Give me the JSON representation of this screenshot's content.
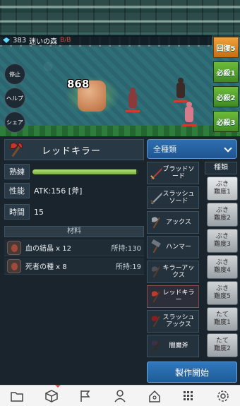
{
  "status": {
    "gems": "383",
    "area": "迷いの森",
    "area_sub": "B/B"
  },
  "side_buttons": [
    "停止",
    "ヘルプ",
    "シェア"
  ],
  "skills": [
    "回復5",
    "必殺1",
    "必殺2",
    "必殺3"
  ],
  "battle": {
    "damage": "868"
  },
  "recipe": {
    "name": "レッドキラー",
    "proficiency_label": "熟練",
    "proficiency_level": 0.98,
    "stat_label": "性能",
    "stat_value": "ATK:156 [斧]",
    "time_label": "時間",
    "time_value": "15"
  },
  "materials": {
    "title": "材料",
    "items": [
      {
        "name": "血の結晶 x 12",
        "owned": "所持:130"
      },
      {
        "name": "死者の種 x 8",
        "owned": "所持:19"
      }
    ]
  },
  "filter": {
    "selected": "全種類"
  },
  "weapons": [
    {
      "label": "ブラッドソード"
    },
    {
      "label": "スラッシュソード"
    },
    {
      "label": "アックス"
    },
    {
      "label": "ハンマー"
    },
    {
      "label": "キラーアックス"
    },
    {
      "label": "レッドキラー"
    },
    {
      "label": "スラッシュアックス"
    },
    {
      "label": "闇魔斧"
    }
  ],
  "categories": {
    "title": "種類",
    "items": [
      {
        "label": "ぶき\n難度1"
      },
      {
        "label": "ぶき\n難度2"
      },
      {
        "label": "ぶき\n難度3"
      },
      {
        "label": "ぶき\n難度4"
      },
      {
        "label": "ぶき\n難度5"
      },
      {
        "label": "たて\n難度1"
      },
      {
        "label": "たて\n難度2"
      }
    ]
  },
  "craft_button": "製作開始",
  "nav": {
    "icons": [
      "folder-icon",
      "box-icon",
      "flag-icon",
      "person-icon",
      "home-icon",
      "grid-icon",
      "gear-icon"
    ]
  },
  "colors": {
    "accent_blue": "#2e6fb0",
    "skill_green": "#6dbb3a",
    "skill_orange": "#f0a23a",
    "proficiency": "#b6e07a"
  }
}
